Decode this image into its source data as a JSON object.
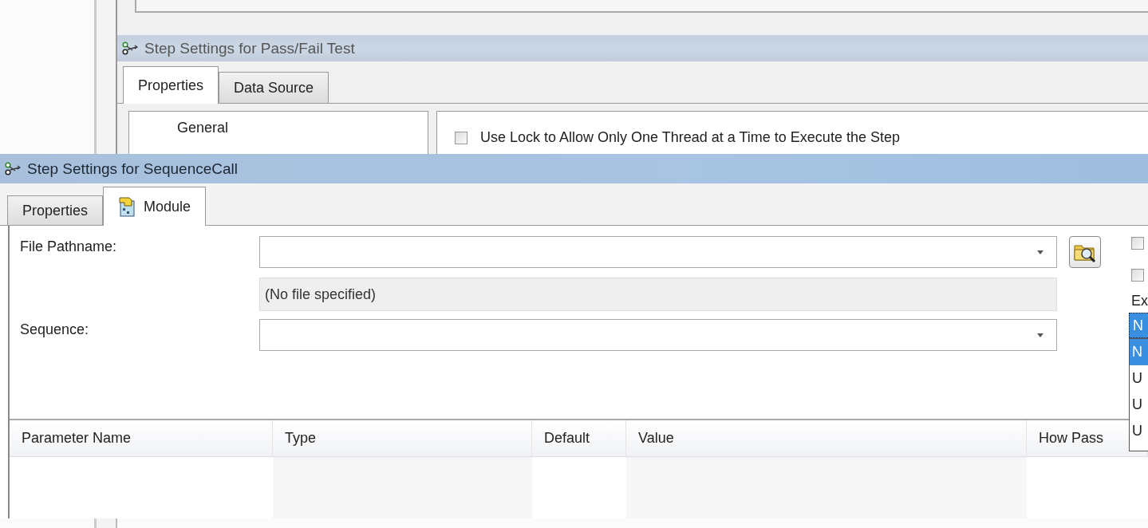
{
  "back_window": {
    "title": "Step Settings for Pass/Fail Test",
    "tabs": [
      {
        "label": "Properties",
        "selected": true
      },
      {
        "label": "Data Source",
        "selected": false
      }
    ],
    "list_items": [
      "General"
    ],
    "options": [
      {
        "label": "Use Lock to Allow Only One Thread at a Time to Execute the Step",
        "checked": false
      }
    ]
  },
  "front_window": {
    "title": "Step Settings for SequenceCall",
    "tabs": [
      {
        "label": "Properties",
        "selected": false,
        "has_icon": false
      },
      {
        "label": "Module",
        "selected": true,
        "has_icon": true
      }
    ],
    "file_pathname": {
      "label": "File Pathname:",
      "status": "(No file specified)"
    },
    "sequence": {
      "label": "Sequence:"
    },
    "side_options": [
      {
        "checked": false
      },
      {
        "checked": false
      }
    ],
    "side_label": "Ex",
    "dropdown": {
      "value": "N",
      "items": [
        {
          "label": "N",
          "selected": true
        },
        {
          "label": "U",
          "selected": false
        },
        {
          "label": "U",
          "selected": false
        },
        {
          "label": "U",
          "selected": false
        }
      ]
    },
    "parameters_table": {
      "columns": [
        "Parameter Name",
        "Type",
        "Default",
        "Value",
        "How Pass"
      ]
    }
  }
}
